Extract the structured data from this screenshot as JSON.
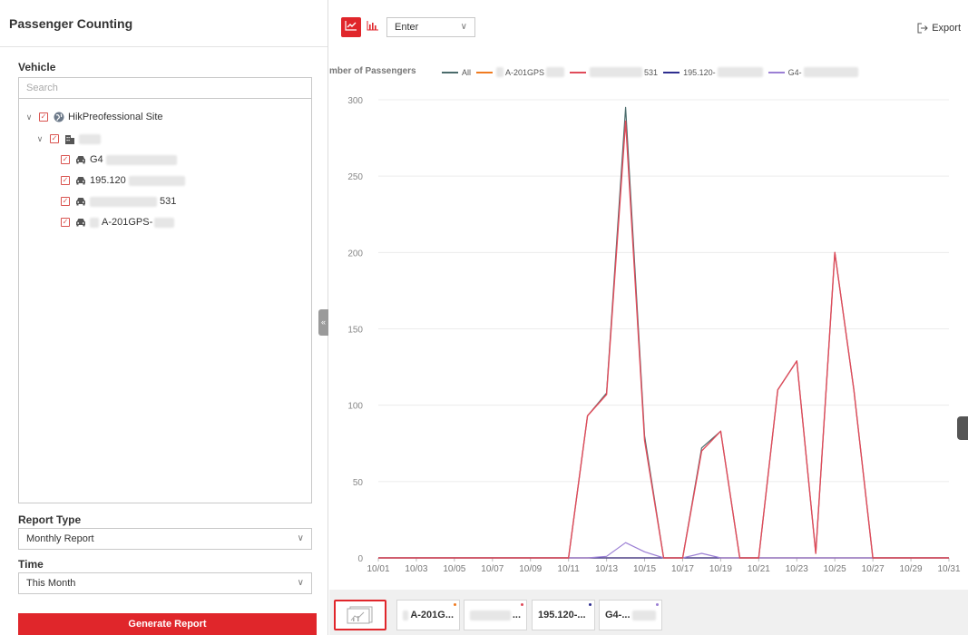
{
  "panel": {
    "title": "Passenger Counting",
    "vehicle_label": "Vehicle",
    "search_placeholder": "Search",
    "tree": {
      "site": "HikPreofessional Site",
      "vehicles": [
        "G4",
        "195.120",
        "531",
        "A-201GPS-"
      ]
    },
    "report_type_label": "Report Type",
    "report_type_value": "Monthly Report",
    "time_label": "Time",
    "time_value": "This Month",
    "generate_label": "Generate Report"
  },
  "toolbar": {
    "mode_value": "Enter",
    "export_label": "Export",
    "line_icon": "line-chart-icon",
    "bar_icon": "bar-chart-icon"
  },
  "chart_data": {
    "type": "line",
    "ylabel": "mber of Passengers",
    "ylim": [
      0,
      300
    ],
    "yticks": [
      0,
      50,
      100,
      150,
      200,
      250,
      300
    ],
    "x": [
      "10/01",
      "10/02",
      "10/03",
      "10/04",
      "10/05",
      "10/06",
      "10/07",
      "10/08",
      "10/09",
      "10/10",
      "10/11",
      "10/12",
      "10/13",
      "10/14",
      "10/15",
      "10/16",
      "10/17",
      "10/18",
      "10/19",
      "10/20",
      "10/21",
      "10/22",
      "10/23",
      "10/24",
      "10/25",
      "10/26",
      "10/27",
      "10/28",
      "10/29",
      "10/30",
      "10/31"
    ],
    "xtick_labels": [
      "10/01",
      "10/03",
      "10/05",
      "10/07",
      "10/09",
      "10/11",
      "10/13",
      "10/15",
      "10/17",
      "10/19",
      "10/21",
      "10/23",
      "10/25",
      "10/27",
      "10/29",
      "10/31"
    ],
    "grid": true,
    "legend_placement": "top",
    "series": [
      {
        "name": "All",
        "color": "#4a6b6b",
        "values": [
          0,
          0,
          0,
          0,
          0,
          0,
          0,
          0,
          0,
          0,
          0,
          93,
          108,
          295,
          80,
          0,
          0,
          72,
          83,
          0,
          0,
          110,
          129,
          3,
          200,
          110,
          0,
          0,
          0,
          0,
          0
        ]
      },
      {
        "name": "A-201GPS",
        "color": "#f07b20",
        "values": [
          0,
          0,
          0,
          0,
          0,
          0,
          0,
          0,
          0,
          0,
          0,
          0,
          0,
          0,
          0,
          0,
          0,
          0,
          0,
          0,
          0,
          0,
          0,
          0,
          0,
          0,
          0,
          0,
          0,
          0,
          0
        ]
      },
      {
        "name": "531",
        "color": "#e04b5a",
        "values": [
          0,
          0,
          0,
          0,
          0,
          0,
          0,
          0,
          0,
          0,
          0,
          93,
          107,
          286,
          77,
          0,
          0,
          70,
          83,
          0,
          0,
          110,
          129,
          3,
          200,
          110,
          0,
          0,
          0,
          0,
          0
        ]
      },
      {
        "name": "195.120-",
        "color": "#2e2e8f",
        "values": [
          0,
          0,
          0,
          0,
          0,
          0,
          0,
          0,
          0,
          0,
          0,
          0,
          0,
          0,
          0,
          0,
          0,
          0,
          0,
          0,
          0,
          0,
          0,
          0,
          0,
          0,
          0,
          0,
          0,
          0,
          0
        ]
      },
      {
        "name": "G4-",
        "color": "#9b7fd4",
        "values": [
          0,
          0,
          0,
          0,
          0,
          0,
          0,
          0,
          0,
          0,
          0,
          0,
          1,
          10,
          4,
          0,
          0,
          3,
          0,
          0,
          0,
          0,
          0,
          0,
          0,
          0,
          0,
          0,
          0,
          0,
          0
        ]
      }
    ]
  },
  "tabs": [
    {
      "label": "A-201G...",
      "dot": "#f07b20"
    },
    {
      "label": "...",
      "dot": "#e04b5a"
    },
    {
      "label": "195.120-...",
      "dot": "#2e2e8f"
    },
    {
      "label": "G4-...",
      "dot": "#9b7fd4"
    }
  ],
  "collapse_glyph": "«"
}
